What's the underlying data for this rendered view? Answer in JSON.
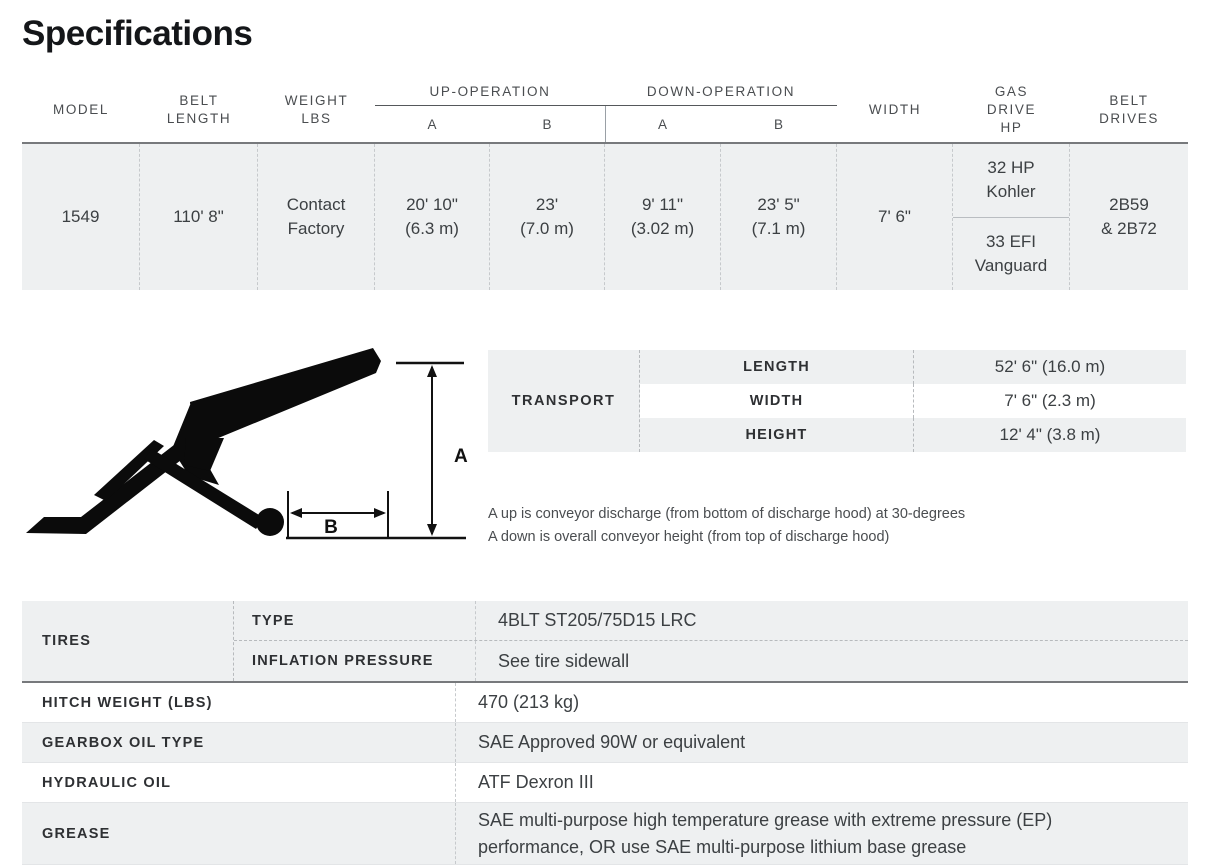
{
  "page_title": "Specifications",
  "spec_table": {
    "headers": {
      "model": "MODEL",
      "belt_length": "BELT\nLENGTH",
      "weight_lbs": "WEIGHT\nLBS",
      "up_operation": "UP-OPERATION",
      "up_a": "A",
      "up_b": "B",
      "down_operation": "DOWN-OPERATION",
      "down_a": "A",
      "down_b": "B",
      "width": "WIDTH",
      "gas_drive_hp": "GAS\nDRIVE\nHP",
      "belt_drives": "BELT\nDRIVES"
    },
    "row": {
      "model": "1549",
      "belt_length": "110' 8\"",
      "weight_lbs": "Contact\nFactory",
      "up_a": "20' 10\"\n(6.3 m)",
      "up_b": "23'\n(7.0 m)",
      "down_a": "9' 11\"\n(3.02 m)",
      "down_b": "23' 5\"\n(7.1 m)",
      "width": "7' 6\"",
      "gas_drive_hp_1": "32 HP\nKohler",
      "gas_drive_hp_2": "33 EFI\nVanguard",
      "belt_drives": "2B59\n& 2B72"
    }
  },
  "diagram": {
    "label_a": "A",
    "label_b": "B"
  },
  "transport": {
    "label": "TRANSPORT",
    "rows": [
      {
        "key": "LENGTH",
        "value": "52' 6\" (16.0 m)"
      },
      {
        "key": "WIDTH",
        "value": "7' 6\" (2.3 m)"
      },
      {
        "key": "HEIGHT",
        "value": "12' 4\" (3.8 m)"
      }
    ]
  },
  "note": {
    "line1": "A up is conveyor discharge (from bottom of discharge hood) at 30-degrees",
    "line2": "A down is overall conveyor height (from top of discharge hood)"
  },
  "bottom_table": {
    "tires": {
      "label": "TIRES",
      "rows": [
        {
          "key": "TYPE",
          "value": "4BLT ST205/75D15 LRC"
        },
        {
          "key": "INFLATION PRESSURE",
          "value": "See tire sidewall"
        }
      ]
    },
    "rows": [
      {
        "key": "HITCH WEIGHT (LBS)",
        "value": "470 (213 kg)"
      },
      {
        "key": "GEARBOX OIL TYPE",
        "value": "SAE Approved 90W or equivalent"
      },
      {
        "key": "HYDRAULIC OIL",
        "value": "ATF Dexron III"
      },
      {
        "key": "GREASE",
        "value": "SAE multi-purpose high temperature grease with extreme pressure (EP)\nperformance, OR use SAE multi-purpose lithium base grease"
      }
    ]
  },
  "colors": {
    "row_gray": "#eef0f1",
    "text": "#3c4043",
    "rule": "#77797c"
  }
}
